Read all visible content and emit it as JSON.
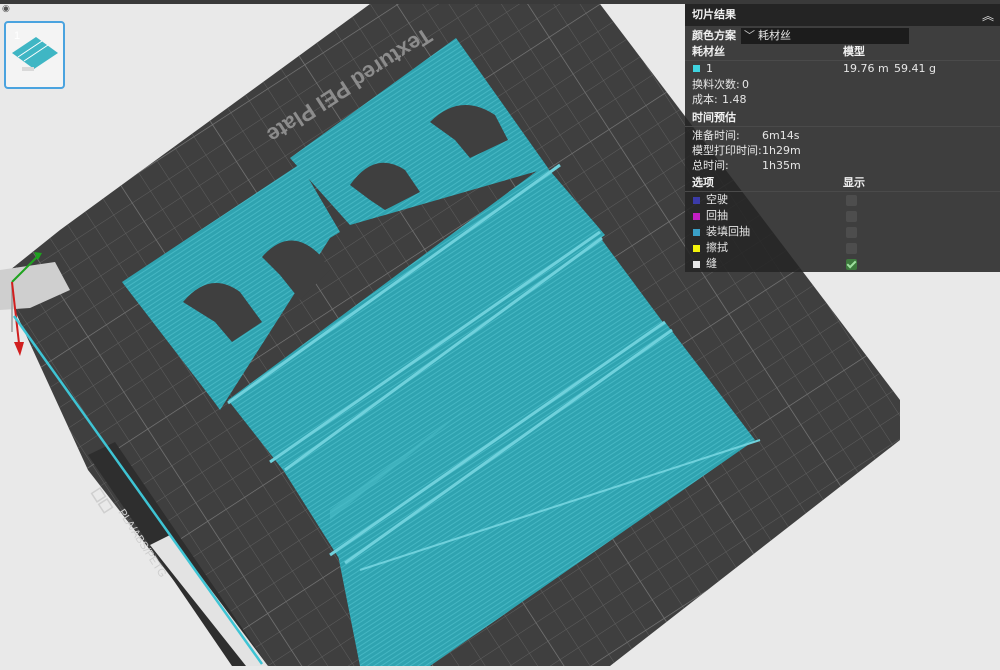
{
  "colors": {
    "background": "#e9e9e9",
    "plate": "#3f3f3f",
    "grid": "#5f5f5f",
    "model": "#2fa3b0",
    "accent": "#4aa3df"
  },
  "plate": {
    "title": "Textured PEI Plate",
    "material_label": "PLA/ABS/PETG"
  },
  "thumbnail": {
    "plate_number": "1",
    "icon": "plate-thumbnail-icon"
  },
  "panel": {
    "title": "切片结果",
    "color_scheme_label": "颜色方案",
    "color_scheme_value": "耗材丝",
    "filament_header": "耗材丝",
    "model_header": "模型",
    "filament_id": "1",
    "filament_length": "19.76 m",
    "filament_weight": "59.41 g",
    "filament_color": "#3fd4e0",
    "changes_label": "换料次数:",
    "changes_value": "0",
    "cost_label": "成本:",
    "cost_value": "1.48",
    "time_section": "时间预估",
    "prep_label": "准备时间:",
    "prep_value": "6m14s",
    "print_label": "模型打印时间:",
    "print_value": "1h29m",
    "total_label": "总时间:",
    "total_value": "1h35m",
    "options_header": "选项",
    "display_header": "显示",
    "options": [
      {
        "label": "空驶",
        "color": "#3b3ba8",
        "shown": false
      },
      {
        "label": "回抽",
        "color": "#c21ec2",
        "shown": false
      },
      {
        "label": "装填回抽",
        "color": "#3aa0c8",
        "shown": false
      },
      {
        "label": "擦拭",
        "color": "#f2f20a",
        "shown": false
      },
      {
        "label": "缝",
        "color": "#e8e8e8",
        "shown": true
      }
    ]
  }
}
